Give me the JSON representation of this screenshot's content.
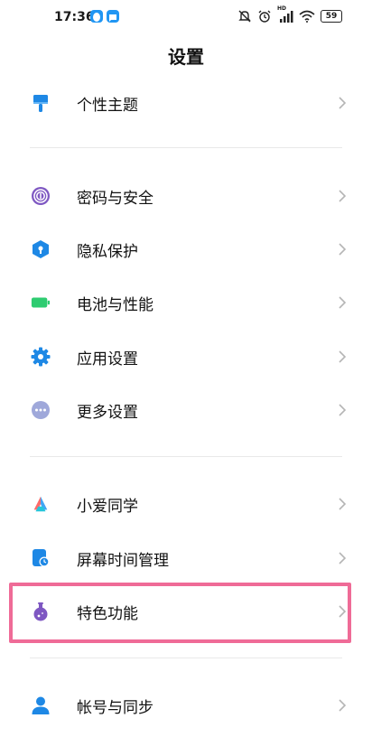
{
  "status_bar": {
    "time": "17:36",
    "battery": "59",
    "signal_label": "HD"
  },
  "header": {
    "title": "设置"
  },
  "groups": [
    {
      "items": [
        {
          "label": "个性主题",
          "icon": "paint-brush-icon"
        }
      ]
    },
    {
      "items": [
        {
          "label": "密码与安全",
          "icon": "fingerprint-icon"
        },
        {
          "label": "隐私保护",
          "icon": "privacy-shield-icon"
        },
        {
          "label": "电池与性能",
          "icon": "battery-icon"
        },
        {
          "label": "应用设置",
          "icon": "gear-icon"
        },
        {
          "label": "更多设置",
          "icon": "more-dots-icon"
        }
      ]
    },
    {
      "items": [
        {
          "label": "小爱同学",
          "icon": "xiaoai-icon"
        },
        {
          "label": "屏幕时间管理",
          "icon": "screen-time-icon"
        },
        {
          "label": "特色功能",
          "icon": "flask-icon",
          "highlighted": true
        }
      ]
    },
    {
      "items": [
        {
          "label": "帐号与同步",
          "icon": "account-icon"
        }
      ]
    }
  ],
  "colors": {
    "highlight_border": "#ef6b97",
    "chevron": "#b5b5b5",
    "divider": "#e9e9e9"
  }
}
